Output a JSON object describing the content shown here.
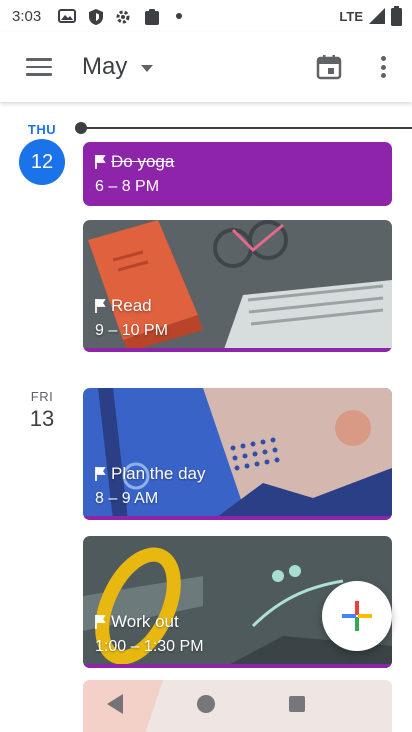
{
  "status_bar": {
    "time": "3:03",
    "network": "LTE"
  },
  "app_bar": {
    "month": "May"
  },
  "days": [
    {
      "day_name": "THU",
      "date": "12",
      "events": [
        {
          "title": "Do yoga",
          "time": "6 – 8 PM",
          "color": "#8e24aa",
          "completed": true
        },
        {
          "title": "Read",
          "time": "9 – 10 PM",
          "color": "#8e24aa",
          "illustration": "books-and-newspaper"
        }
      ]
    },
    {
      "day_name": "FRI",
      "date": "13",
      "events": [
        {
          "title": "Plan the day",
          "time": "8 – 9 AM",
          "color": "#8e24aa",
          "illustration": "notebook-and-pen"
        },
        {
          "title": "Work out",
          "time": "1:00 – 1:30 PM",
          "color": "#8e24aa",
          "illustration": "sport-equipment"
        }
      ]
    }
  ],
  "accent_color": "#1a73e8",
  "fab_icon": "add-icon"
}
